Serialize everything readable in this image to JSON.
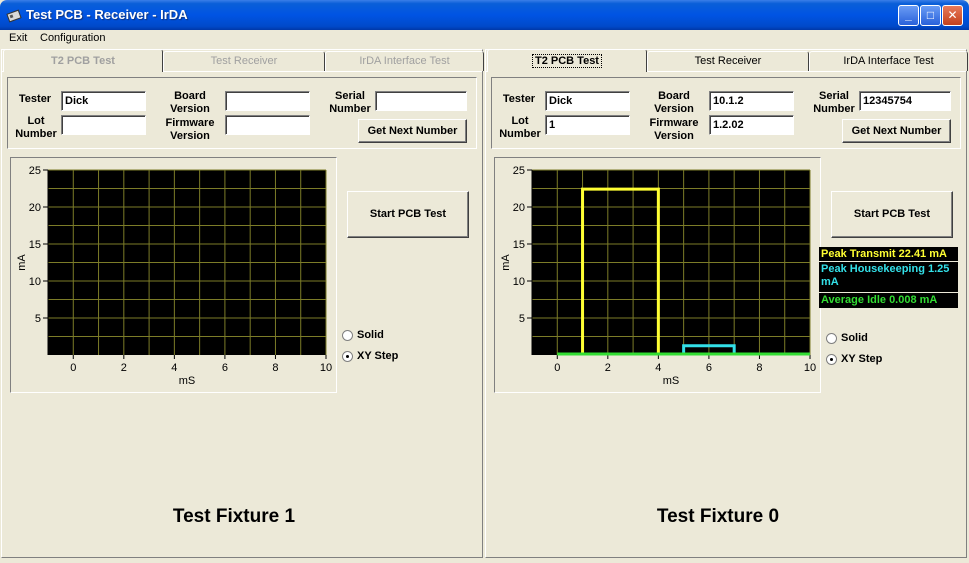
{
  "window": {
    "title": "Test PCB - Receiver - IrDA",
    "minimize": "_",
    "maximize": "□",
    "close": "✕"
  },
  "menu": [
    "Exit",
    "Configuration"
  ],
  "labels": {
    "tester": "Tester",
    "lot_number": "Lot Number",
    "board_version": "Board Version",
    "firmware_version": "Firmware Version",
    "serial_number": "Serial Number",
    "get_next_number": "Get Next Number",
    "start_pcb_test": "Start PCB Test",
    "solid": "Solid",
    "xy_step": "XY Step",
    "y_axis": "mA",
    "x_axis": "mS"
  },
  "panels": [
    {
      "tabs": [
        "T2 PCB Test",
        "Test Receiver",
        "IrDA Interface Test"
      ],
      "tabs_enabled": false,
      "tester": "Dick",
      "lot_number": "",
      "board_version": "",
      "firmware_version": "",
      "serial_number": "",
      "fixture_label": "Test Fixture 1",
      "selected_plot_mode": "XY Step",
      "legend": null
    },
    {
      "tabs": [
        "T2 PCB Test",
        "Test Receiver",
        "IrDA Interface Test"
      ],
      "tabs_enabled": true,
      "tester": "Dick",
      "lot_number": "1",
      "board_version": "10.1.2",
      "firmware_version": "1.2.02",
      "serial_number": "12345754",
      "fixture_label": "Test Fixture 0",
      "selected_plot_mode": "XY Step",
      "legend": {
        "peak_transmit": "Peak Transmit  22.41 mA",
        "peak_housekeeping": "Peak Housekeeping  1.25 mA",
        "average_idle": "Average Idle  0.008 mA"
      }
    }
  ],
  "colors": {
    "transmit": "#ffff33",
    "housekeeping": "#33e0e8",
    "idle": "#33dd33",
    "grid": "#7c7c28",
    "plot_bg": "#000000"
  },
  "chart_data": [
    {
      "type": "line",
      "xlabel": "mS",
      "ylabel": "mA",
      "xlim": [
        -1,
        10
      ],
      "ylim": [
        0,
        25
      ],
      "x_ticks": [
        0,
        2,
        4,
        6,
        8,
        10
      ],
      "y_ticks": [
        5,
        10,
        15,
        20,
        25
      ],
      "grid": true,
      "series": []
    },
    {
      "type": "line",
      "xlabel": "mS",
      "ylabel": "mA",
      "xlim": [
        -1,
        10
      ],
      "ylim": [
        0,
        25
      ],
      "x_ticks": [
        0,
        2,
        4,
        6,
        8,
        10
      ],
      "y_ticks": [
        5,
        10,
        15,
        20,
        25
      ],
      "grid": true,
      "series": [
        {
          "name": "Peak Transmit",
          "color": "#ffff33",
          "x": [
            1,
            1,
            4,
            4
          ],
          "y": [
            0,
            22.41,
            22.41,
            0
          ]
        },
        {
          "name": "Peak Housekeeping",
          "color": "#33e0e8",
          "x": [
            5,
            5,
            7,
            7
          ],
          "y": [
            0,
            1.25,
            1.25,
            0
          ]
        },
        {
          "name": "Average Idle",
          "color": "#33dd33",
          "x": [
            0,
            10
          ],
          "y": [
            0.008,
            0.008
          ]
        }
      ]
    }
  ]
}
